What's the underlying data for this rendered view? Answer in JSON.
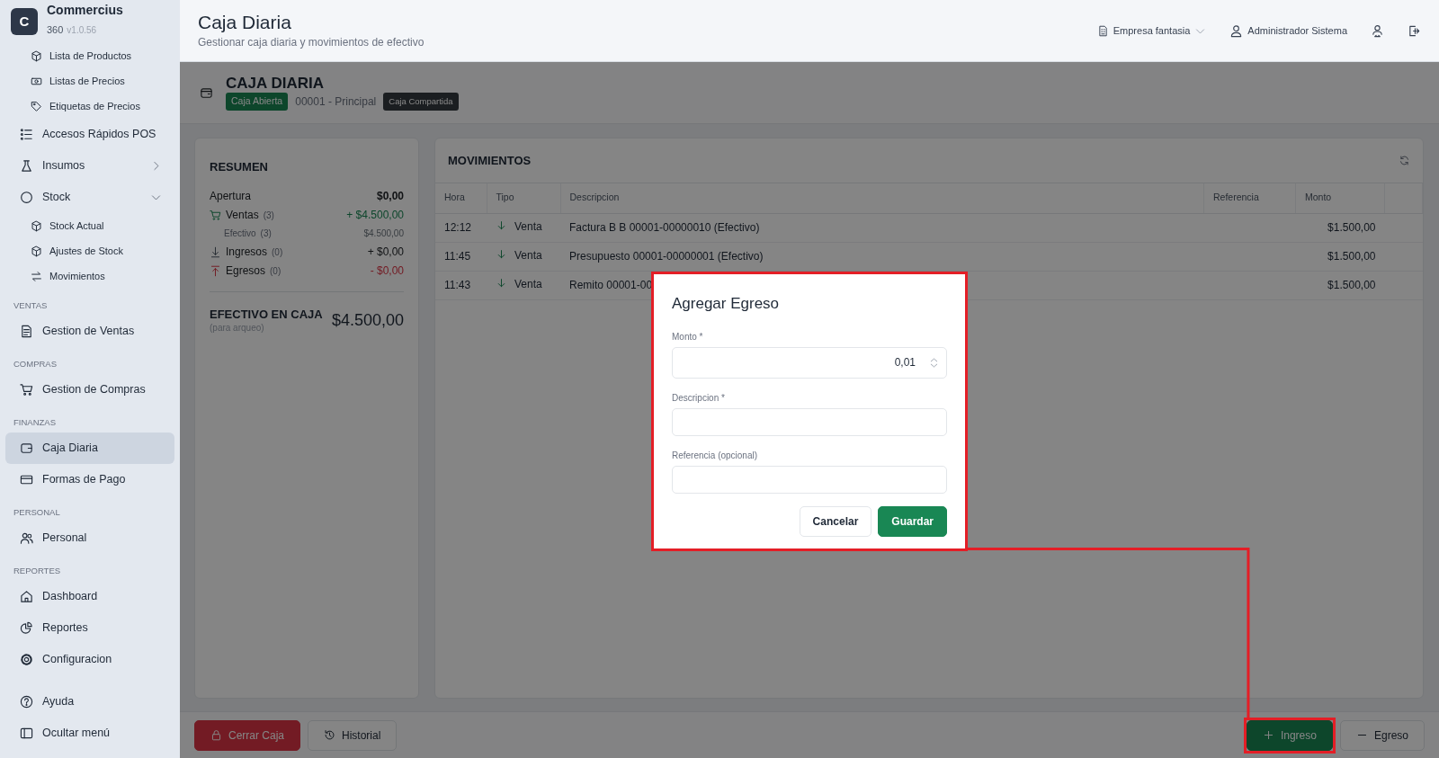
{
  "app": {
    "logo_letter": "C",
    "name": "Commercius",
    "edition": "360",
    "version": "v1.0.56"
  },
  "sidebar": {
    "items": [
      {
        "kind": "group",
        "children": [
          {
            "label": "Lista de Productos",
            "selected": false
          },
          {
            "label": "Listas de Precios",
            "selected": false
          },
          {
            "label": "Etiquetas de Precios",
            "selected": false
          }
        ]
      },
      {
        "kind": "link",
        "label": "Accesos Rápidos POS",
        "selected": false
      },
      {
        "kind": "link",
        "label": "Insumos",
        "selected": false,
        "expanded": false
      },
      {
        "kind": "link",
        "label": "Stock",
        "selected": false,
        "expanded": true,
        "children": [
          {
            "label": "Stock Actual",
            "selected": false
          },
          {
            "label": "Ajustes de Stock",
            "selected": false
          },
          {
            "label": "Movimientos",
            "selected": false
          }
        ]
      },
      {
        "kind": "heading",
        "label": "VENTAS"
      },
      {
        "kind": "link",
        "label": "Gestion de Ventas",
        "selected": false
      },
      {
        "kind": "heading",
        "label": "COMPRAS"
      },
      {
        "kind": "link",
        "label": "Gestion de Compras",
        "selected": false
      },
      {
        "kind": "heading",
        "label": "FINANZAS"
      },
      {
        "kind": "link",
        "label": "Caja Diaria",
        "selected": true
      },
      {
        "kind": "link",
        "label": "Formas de Pago",
        "selected": false
      },
      {
        "kind": "heading",
        "label": "PERSONAL"
      },
      {
        "kind": "link",
        "label": "Personal",
        "selected": false
      },
      {
        "kind": "heading",
        "label": "REPORTES"
      },
      {
        "kind": "link",
        "label": "Dashboard",
        "selected": false
      },
      {
        "kind": "link",
        "label": "Reportes",
        "selected": false
      },
      {
        "kind": "link",
        "label": "Configuracion",
        "selected": false
      }
    ],
    "footer_items": [
      {
        "label": "Ayuda",
        "selected": false
      },
      {
        "label": "Ocultar menú",
        "selected": false
      }
    ]
  },
  "header": {
    "title": "Caja Diaria",
    "subtitle": "Gestionar caja diaria y movimientos de efectivo",
    "company": "Empresa fantasia",
    "user": "Administrador Sistema"
  },
  "caja": {
    "title": "CAJA DIARIA",
    "status_badge": "Caja Abierta",
    "register": "00001 - Principal",
    "shared_badge": "Caja Compartida"
  },
  "resumen": {
    "title": "RESUMEN",
    "rows": [
      {
        "kind": "opening",
        "label": "Apertura",
        "amount": "$0,00"
      },
      {
        "kind": "sales",
        "label": "Ventas",
        "count": "(3)",
        "amount": "+ $4.500,00"
      },
      {
        "kind": "detail",
        "label": "Efectivo",
        "count": "(3)",
        "amount": "$4.500,00"
      },
      {
        "kind": "income",
        "label": "Ingresos",
        "count": "(0)",
        "amount": "+ $0,00"
      },
      {
        "kind": "expense",
        "label": "Egresos",
        "count": "(0)",
        "amount": "- $0,00"
      }
    ],
    "total": {
      "label": "EFECTIVO EN CAJA",
      "note": "(para arqueo)",
      "amount": "$4.500,00"
    }
  },
  "movimientos": {
    "title": "MOVIMIENTOS",
    "columns": [
      "Hora",
      "Tipo",
      "Descripcion",
      "Referencia",
      "Monto"
    ],
    "rows": [
      {
        "hora": "12:12",
        "tipo": "Venta",
        "descripcion": "Factura B B 00001-00000010 (Efectivo)",
        "monto": "$1.500,00"
      },
      {
        "hora": "11:45",
        "tipo": "Venta",
        "descripcion": "Presupuesto 00001-00000001 (Efectivo)",
        "monto": "$1.500,00"
      },
      {
        "hora": "11:43",
        "tipo": "Venta",
        "descripcion": "Remito 00001-00",
        "monto": "$1.500,00"
      }
    ]
  },
  "actions": [
    {
      "kind": "close",
      "label": "Cerrar Caja",
      "highlighted": false
    },
    {
      "kind": "history",
      "label": "Historial",
      "highlighted": false
    },
    {
      "kind": "income",
      "label": "Ingreso",
      "highlighted": true
    },
    {
      "kind": "expense",
      "label": "Egreso",
      "highlighted": false
    }
  ],
  "modal": {
    "title": "Agregar Egreso",
    "highlighted": true,
    "fields": [
      {
        "kind": "number",
        "label": "Monto *",
        "value": "0,01"
      },
      {
        "kind": "text",
        "label": "Descripcion *"
      },
      {
        "kind": "text",
        "label": "Referencia (opcional)"
      }
    ],
    "buttons": [
      {
        "kind": "secondary",
        "label": "Cancelar"
      },
      {
        "kind": "primary",
        "label": "Guardar"
      }
    ]
  }
}
